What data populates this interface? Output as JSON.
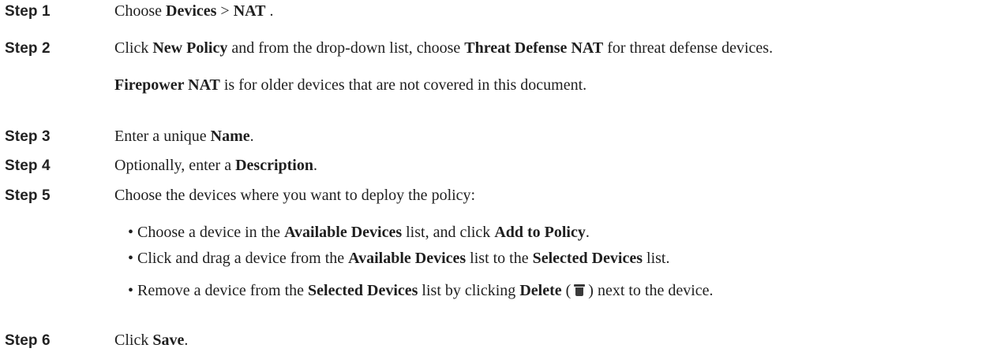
{
  "steps": [
    {
      "label": "Step 1",
      "parts": {
        "a": "Choose ",
        "b": "Devices",
        "c": " > ",
        "d": "NAT",
        "e": " ."
      }
    },
    {
      "label": "Step 2",
      "parts": {
        "a": "Click ",
        "b": "New Policy",
        "c": " and from the drop-down list, choose ",
        "d": "Threat Defense NAT",
        "e": " for threat defense devices."
      },
      "note": {
        "b": "Firepower NAT",
        "c": " is for older devices that are not covered in this document."
      }
    },
    {
      "label": "Step 3",
      "parts": {
        "a": "Enter a unique ",
        "b": "Name",
        "c": "."
      }
    },
    {
      "label": "Step 4",
      "parts": {
        "a": "Optionally, enter a ",
        "b": "Description",
        "c": "."
      }
    },
    {
      "label": "Step 5",
      "parts": {
        "a": "Choose the devices where you want to deploy the policy:"
      },
      "bullets": [
        {
          "a": "• Choose a device in the ",
          "b": "Available Devices",
          "c": " list, and click ",
          "d": "Add to Policy",
          "e": "."
        },
        {
          "a": "• Click and drag a device from the ",
          "b": "Available Devices",
          "c": " list to the ",
          "d": "Selected Devices",
          "e": " list."
        },
        {
          "a": "• Remove a device from the ",
          "b": "Selected Devices",
          "c": " list by clicking ",
          "d": "Delete",
          "e": " (",
          "f": ") next to the device.",
          "icon": "trash-icon"
        }
      ]
    },
    {
      "label": "Step 6",
      "parts": {
        "a": "Click ",
        "b": "Save",
        "c": "."
      }
    }
  ]
}
